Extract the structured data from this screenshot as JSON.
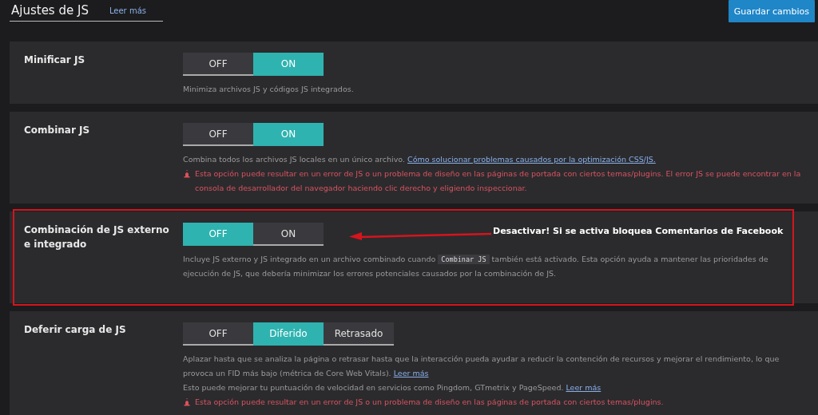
{
  "header": {
    "title": "Ajustes de JS",
    "link": "Leer más",
    "save_button": "Guardar cambios"
  },
  "settings": [
    {
      "label": "Minificar JS",
      "options": [
        {
          "label": "OFF",
          "selected": false
        },
        {
          "label": "ON",
          "selected": true
        }
      ],
      "paragraphs": [
        {
          "kind": "note",
          "parts": [
            {
              "kind": "text",
              "text": "Minimiza archivos JS y códigos JS integrados."
            }
          ]
        }
      ]
    },
    {
      "label": "Combinar JS",
      "options": [
        {
          "label": "OFF",
          "selected": false
        },
        {
          "label": "ON",
          "selected": true
        }
      ],
      "paragraphs": [
        {
          "kind": "note",
          "parts": [
            {
              "kind": "text",
              "text": "Combina todos los archivos JS locales en un único archivo. "
            },
            {
              "kind": "link",
              "text": "Cómo solucionar problemas causados por la optimización CSS/JS."
            }
          ]
        },
        {
          "kind": "warning",
          "text": "Esta opción puede resultar en un error de JS o un problema de diseño en las páginas de portada con ciertos temas/plugins. El error JS se puede encontrar en la consola de desarrollador del navegador haciendo clic derecho y eligiendo inspeccionar."
        }
      ]
    },
    {
      "label": "Combinación de JS externo e integrado",
      "options": [
        {
          "label": "OFF",
          "selected": true
        },
        {
          "label": "ON",
          "selected": false
        }
      ],
      "paragraphs": [
        {
          "kind": "note",
          "parts": [
            {
              "kind": "text",
              "text": "Incluye JS externo y JS integrado en un archivo combinado cuando "
            },
            {
              "kind": "code",
              "text": "Combinar JS"
            },
            {
              "kind": "text",
              "text": " también está activado. Esta opción ayuda a mantener las prioridades de ejecución de JS, que debería minimizar los errores potenciales causados por la combinación de JS."
            }
          ]
        }
      ],
      "annotation": {
        "text": "Desactivar! Si se activa bloquea Comentarios de Facebook"
      }
    },
    {
      "label": "Deferir carga de JS",
      "options": [
        {
          "label": "OFF",
          "selected": false
        },
        {
          "label": "Diferido",
          "selected": true
        },
        {
          "label": "Retrasado",
          "selected": false
        }
      ],
      "paragraphs": [
        {
          "kind": "note",
          "parts": [
            {
              "kind": "text",
              "text": "Aplazar hasta que se analiza la página o retrasar hasta que la interacción pueda ayudar a reducir la contención de recursos y mejorar el rendimiento, lo que provoca un FID más bajo (métrica de Core Web Vitals). "
            },
            {
              "kind": "link",
              "text": "Leer más"
            }
          ]
        },
        {
          "kind": "note",
          "parts": [
            {
              "kind": "text",
              "text": "Esto puede mejorar tu puntuación de velocidad en servicios como Pingdom, GTmetrix y PageSpeed. "
            },
            {
              "kind": "link",
              "text": "Leer más"
            }
          ]
        },
        {
          "kind": "warning",
          "text": "Esta opción puede resultar en un error de JS o un problema de diseño en las páginas de portada con ciertos temas/plugins."
        }
      ]
    }
  ]
}
